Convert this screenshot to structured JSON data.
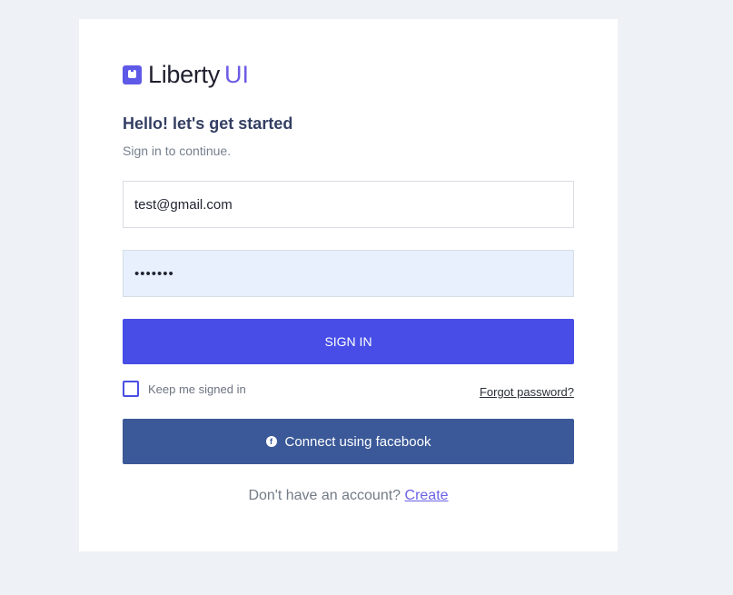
{
  "brand": {
    "name": "Liberty",
    "accent": "UI",
    "accent_color": "#6c5be6",
    "logo_icon": "liberty-logo-icon"
  },
  "heading": {
    "title": "Hello! let's get started",
    "subtitle": "Sign in to continue."
  },
  "form": {
    "email_value": "test@gmail.com",
    "password_value": "•••••••",
    "signin_label": "SIGN IN",
    "keep_signed_in_label": "Keep me signed in",
    "keep_signed_in_checked": false,
    "forgot_password_label": "Forgot password?",
    "facebook_label": "Connect using facebook",
    "facebook_icon": "facebook-icon"
  },
  "footer": {
    "prompt": "Don't have an account?",
    "create_label": "Create"
  },
  "colors": {
    "primary": "#474de6",
    "facebook": "#3b5998",
    "page_background": "#eef1f5"
  }
}
